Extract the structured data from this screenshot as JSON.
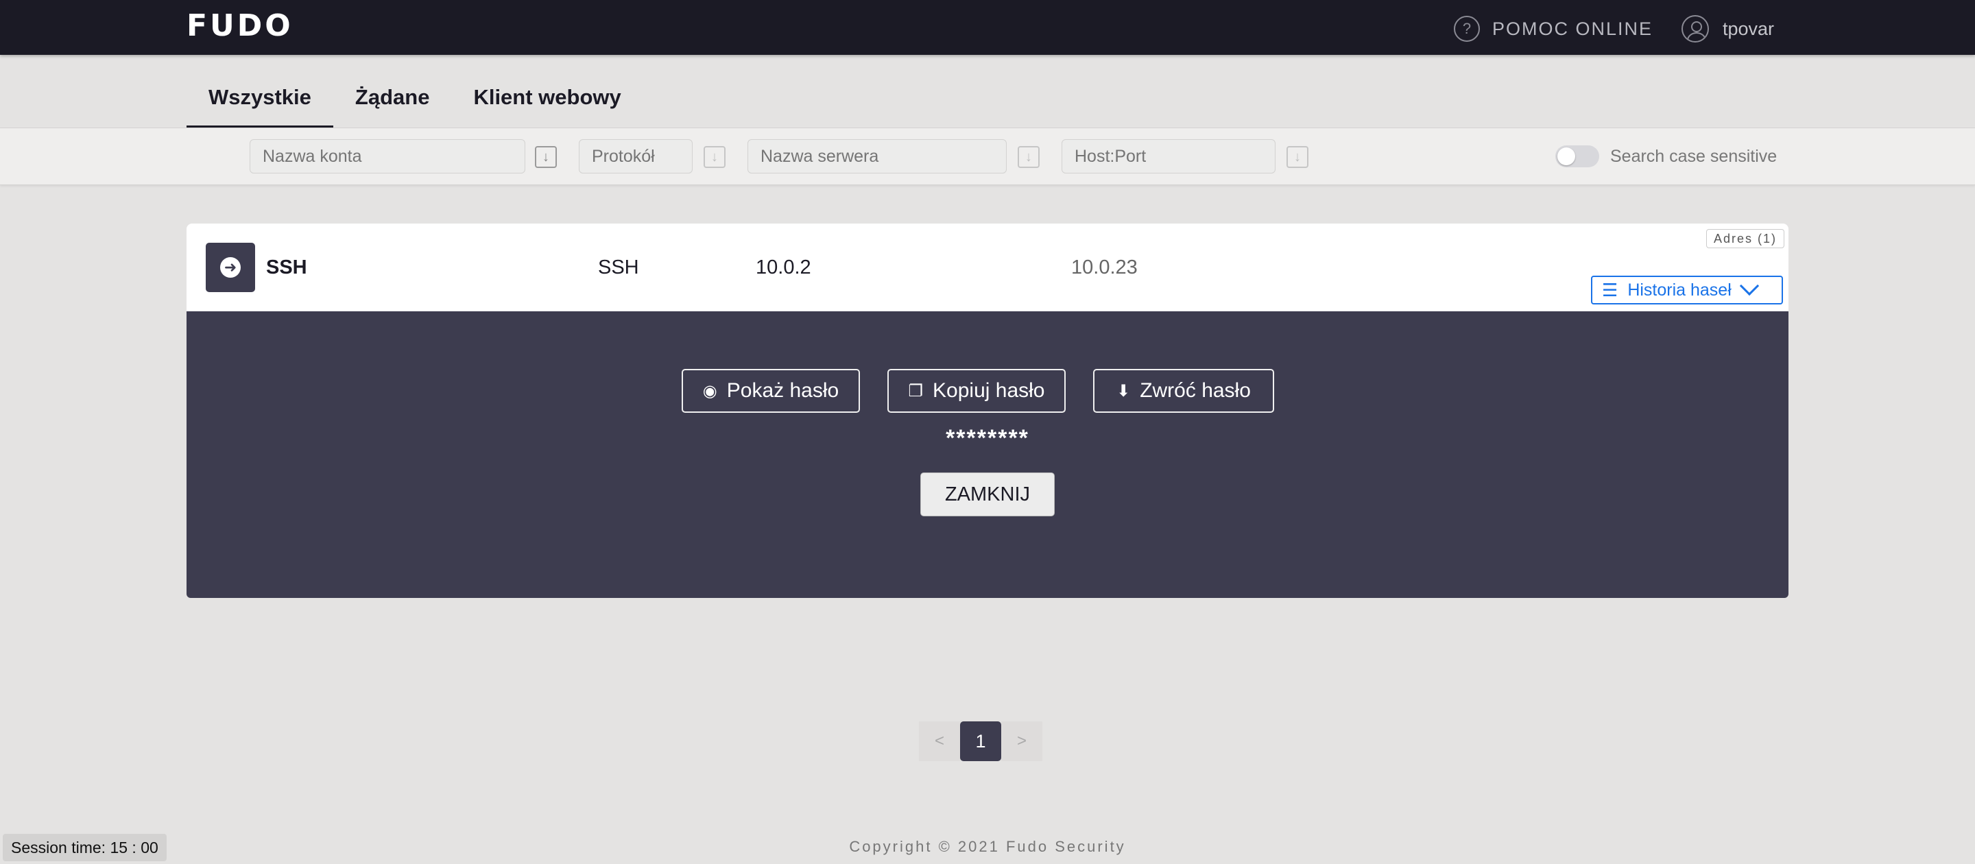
{
  "header": {
    "logo": "FUDO",
    "help_icon": "question-circle-icon",
    "help_label": "POMOC ONLINE",
    "user_icon": "user-circle-icon",
    "username": "tpovar"
  },
  "tabs": [
    {
      "label": "Wszystkie",
      "active": true
    },
    {
      "label": "Żądane",
      "active": false
    },
    {
      "label": "Klient webowy",
      "active": false
    }
  ],
  "filters": {
    "account_placeholder": "Nazwa konta",
    "protocol_placeholder": "Protokół",
    "server_placeholder": "Nazwa serwera",
    "hostport_placeholder": "Host:Port",
    "sort_icon": "arrow-down-icon",
    "case_sensitive_label": "Search case sensitive",
    "case_sensitive_on": false
  },
  "row": {
    "icon": "arrow-right-circle-icon",
    "name": "SSH",
    "protocol": "SSH",
    "server": "10.0.2",
    "host": "10.0.23",
    "adres_badge": "Adres (1)",
    "history_label": "Historia haseł",
    "history_icon": "list-icon"
  },
  "panel": {
    "show_label": "Pokaż hasło",
    "show_icon": "eye-icon",
    "copy_label": "Kopiuj hasło",
    "copy_icon": "copy-icon",
    "return_label": "Zwróć hasło",
    "return_icon": "download-icon",
    "masked_password": "********",
    "close_label": "ZAMKNIJ"
  },
  "pagination": {
    "prev": "<",
    "current": "1",
    "next": ">"
  },
  "footer": {
    "copyright": "Copyright © 2021 Fudo Security",
    "session": "Session time: 15 : 00"
  }
}
